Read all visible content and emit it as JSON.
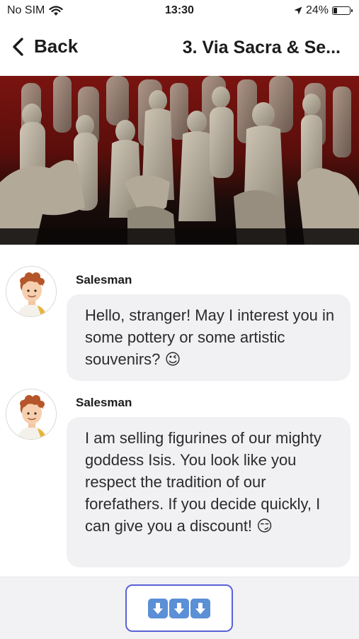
{
  "status_bar": {
    "carrier": "No SIM",
    "time": "13:30",
    "battery_percent": "24%",
    "battery_level": 0.24,
    "icons": [
      "wifi-icon",
      "location-arrow-icon",
      "battery-icon"
    ]
  },
  "nav": {
    "back_label": "Back",
    "title": "3. Via Sacra & Se..."
  },
  "hero": {
    "description": "figurines-photo"
  },
  "messages": [
    {
      "sender": "Salesman",
      "text": "Hello, stranger! May I interest you in some pottery or some artistic souvenirs? 😉"
    },
    {
      "sender": "Salesman",
      "text": "I am selling figurines of our mighty goddess Isis. You look like you respect the tradition of our forefathers. If you decide quickly, I can give you a discount! 😏"
    }
  ],
  "bottom": {
    "button_label": "⬇⬇⬇",
    "accent_color": "#5a63d6",
    "arrow_color": "#5b8fd6"
  }
}
